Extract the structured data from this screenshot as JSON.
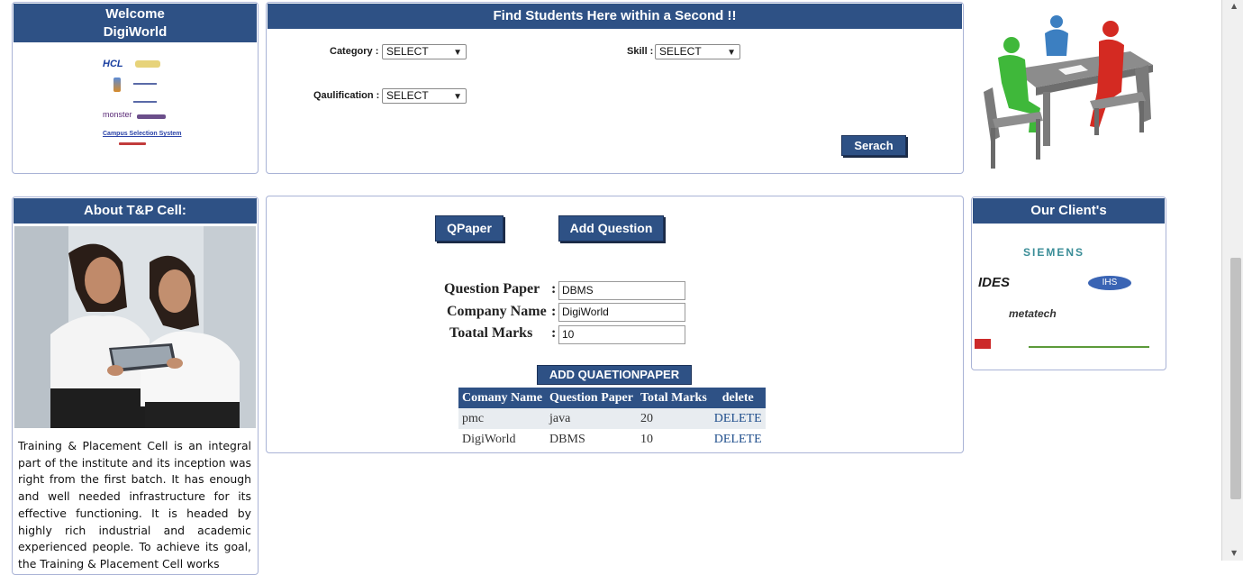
{
  "welcome": {
    "title_line1": "Welcome",
    "title_line2": "DigiWorld",
    "logos": {
      "hcl": "HCL",
      "monster": "monster",
      "campus": "Campus Selection System"
    }
  },
  "search": {
    "title": "Find Students Here within a Second !!",
    "category_label": "Category",
    "category_value": "SELECT",
    "skill_label": "Skill :",
    "skill_value": "SELECT",
    "qualification_label": "Qaulification :",
    "qualification_value": "SELECT",
    "search_button": "Serach"
  },
  "about": {
    "title": "About T&P Cell:",
    "text": "Training & Placement Cell is an integral part of the institute and its inception was right from the first batch. It has enough and well needed infrastructure for its effective functioning. It is headed by highly rich industrial and academic experienced people. To achieve its goal, the Training & Placement Cell works"
  },
  "main": {
    "qpaper_button": "QPaper",
    "add_question_button": "Add Question",
    "question_paper_label": "Question Paper",
    "question_paper_value": "DBMS",
    "company_name_label": "Company Name",
    "company_name_value": "DigiWorld",
    "total_marks_label": "Toatal Marks",
    "total_marks_value": "10",
    "add_button": "ADD QUAETIONPAPER",
    "colon": ":",
    "table": {
      "headers": [
        "Comany Name",
        "Question Paper",
        "Total Marks",
        "delete"
      ],
      "rows": [
        [
          "pmc",
          "java",
          "20",
          "DELETE"
        ],
        [
          "DigiWorld",
          "DBMS",
          "10",
          "DELETE"
        ]
      ]
    }
  },
  "clients": {
    "title": "Our Client's",
    "logos": [
      "SIEMENS",
      "IDES",
      "IHS",
      "metatech"
    ]
  },
  "icons": [
    "chevron-down-icon",
    "scroll-up-icon",
    "scroll-down-icon"
  ],
  "colors": {
    "header_blue": "#2e5185",
    "panel_border": "#a9b3d6",
    "link_blue": "#1f4e8c"
  }
}
